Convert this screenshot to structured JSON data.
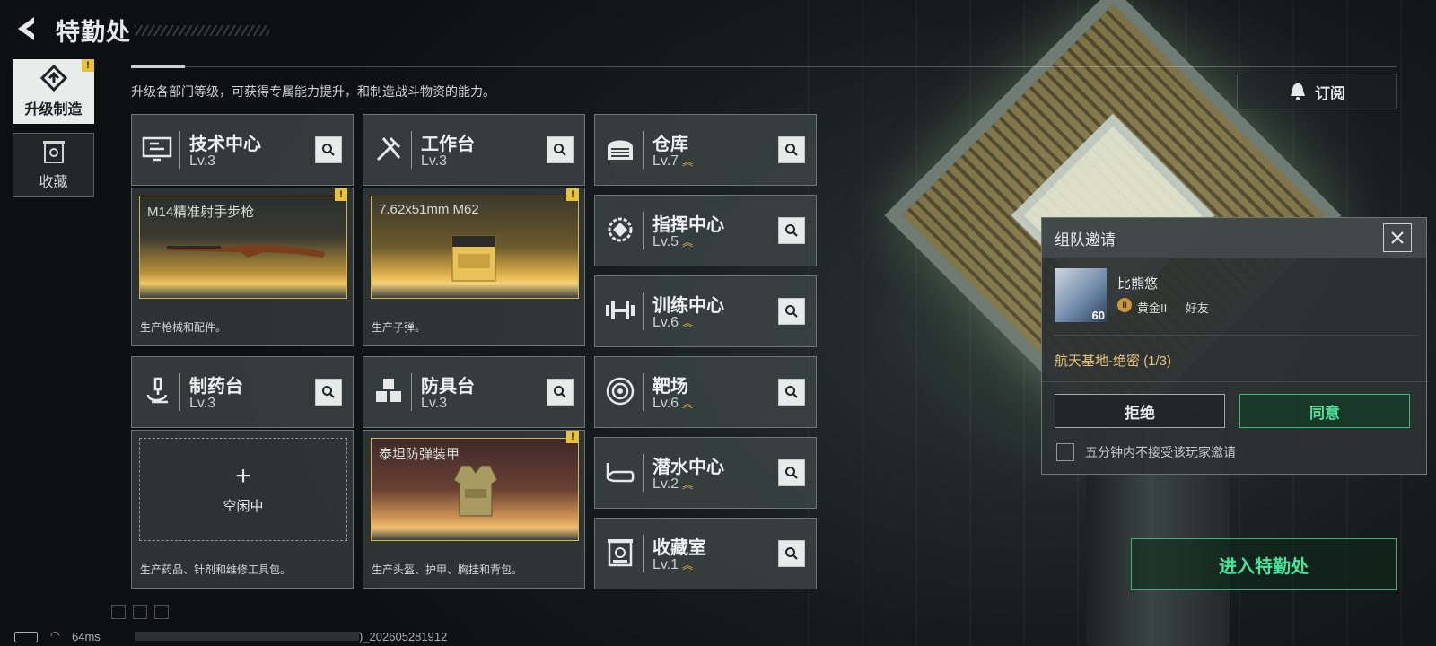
{
  "header": {
    "title": "特勤处"
  },
  "side_tabs": [
    {
      "label": "升级制造",
      "icon": "upgrade-icon",
      "active": true
    },
    {
      "label": "收藏",
      "icon": "collection-icon",
      "active": false
    }
  ],
  "description": "升级各部门等级，可获得专属能力提升，和制造战斗物资的能力。",
  "subscribe_label": "订阅",
  "departments": [
    {
      "name": "技术中心",
      "level": "Lv.3",
      "icon": "monitor-icon"
    },
    {
      "name": "工作台",
      "level": "Lv.3",
      "icon": "tools-icon"
    },
    {
      "name": "制药台",
      "level": "Lv.3",
      "icon": "microscope-icon"
    },
    {
      "name": "防具台",
      "level": "Lv.3",
      "icon": "cubes-icon"
    },
    {
      "name": "仓库",
      "level": "Lv.7",
      "icon": "warehouse-icon"
    },
    {
      "name": "指挥中心",
      "level": "Lv.5",
      "icon": "chip-icon"
    },
    {
      "name": "训练中心",
      "level": "Lv.6",
      "icon": "dumbbell-icon"
    },
    {
      "name": "靶场",
      "level": "Lv.6",
      "icon": "target-icon"
    },
    {
      "name": "潜水中心",
      "level": "Lv.2",
      "icon": "diving-mask-icon"
    },
    {
      "name": "收藏室",
      "level": "Lv.1",
      "icon": "collection-room-icon"
    }
  ],
  "productions": [
    {
      "item": "M14精准射手步枪",
      "note": "生产枪械和配件。"
    },
    {
      "item": "7.62x51mm M62",
      "note": "生产子弹。"
    },
    {
      "item": "空闲中",
      "note": "生产药品、针剂和维修工具包。"
    },
    {
      "item": "泰坦防弹装甲",
      "note": "生产头盔、护甲、胸挂和背包。"
    }
  ],
  "invite": {
    "title": "组队邀请",
    "player_name": "比熊悠",
    "player_level": "60",
    "rank": "黄金II",
    "relation": "好友",
    "mode": "航天基地-绝密 (1/3)",
    "refuse": "拒绝",
    "accept": "同意",
    "checkbox_label": "五分钟内不接受该玩家邀请"
  },
  "enter_button": "进入特勤处",
  "status_bar": {
    "ping": "64ms",
    "build": ")_202605281912"
  },
  "colors": {
    "accent_green": "#46e59a",
    "gold": "#e3b64a",
    "warn": "#e8c23a"
  }
}
